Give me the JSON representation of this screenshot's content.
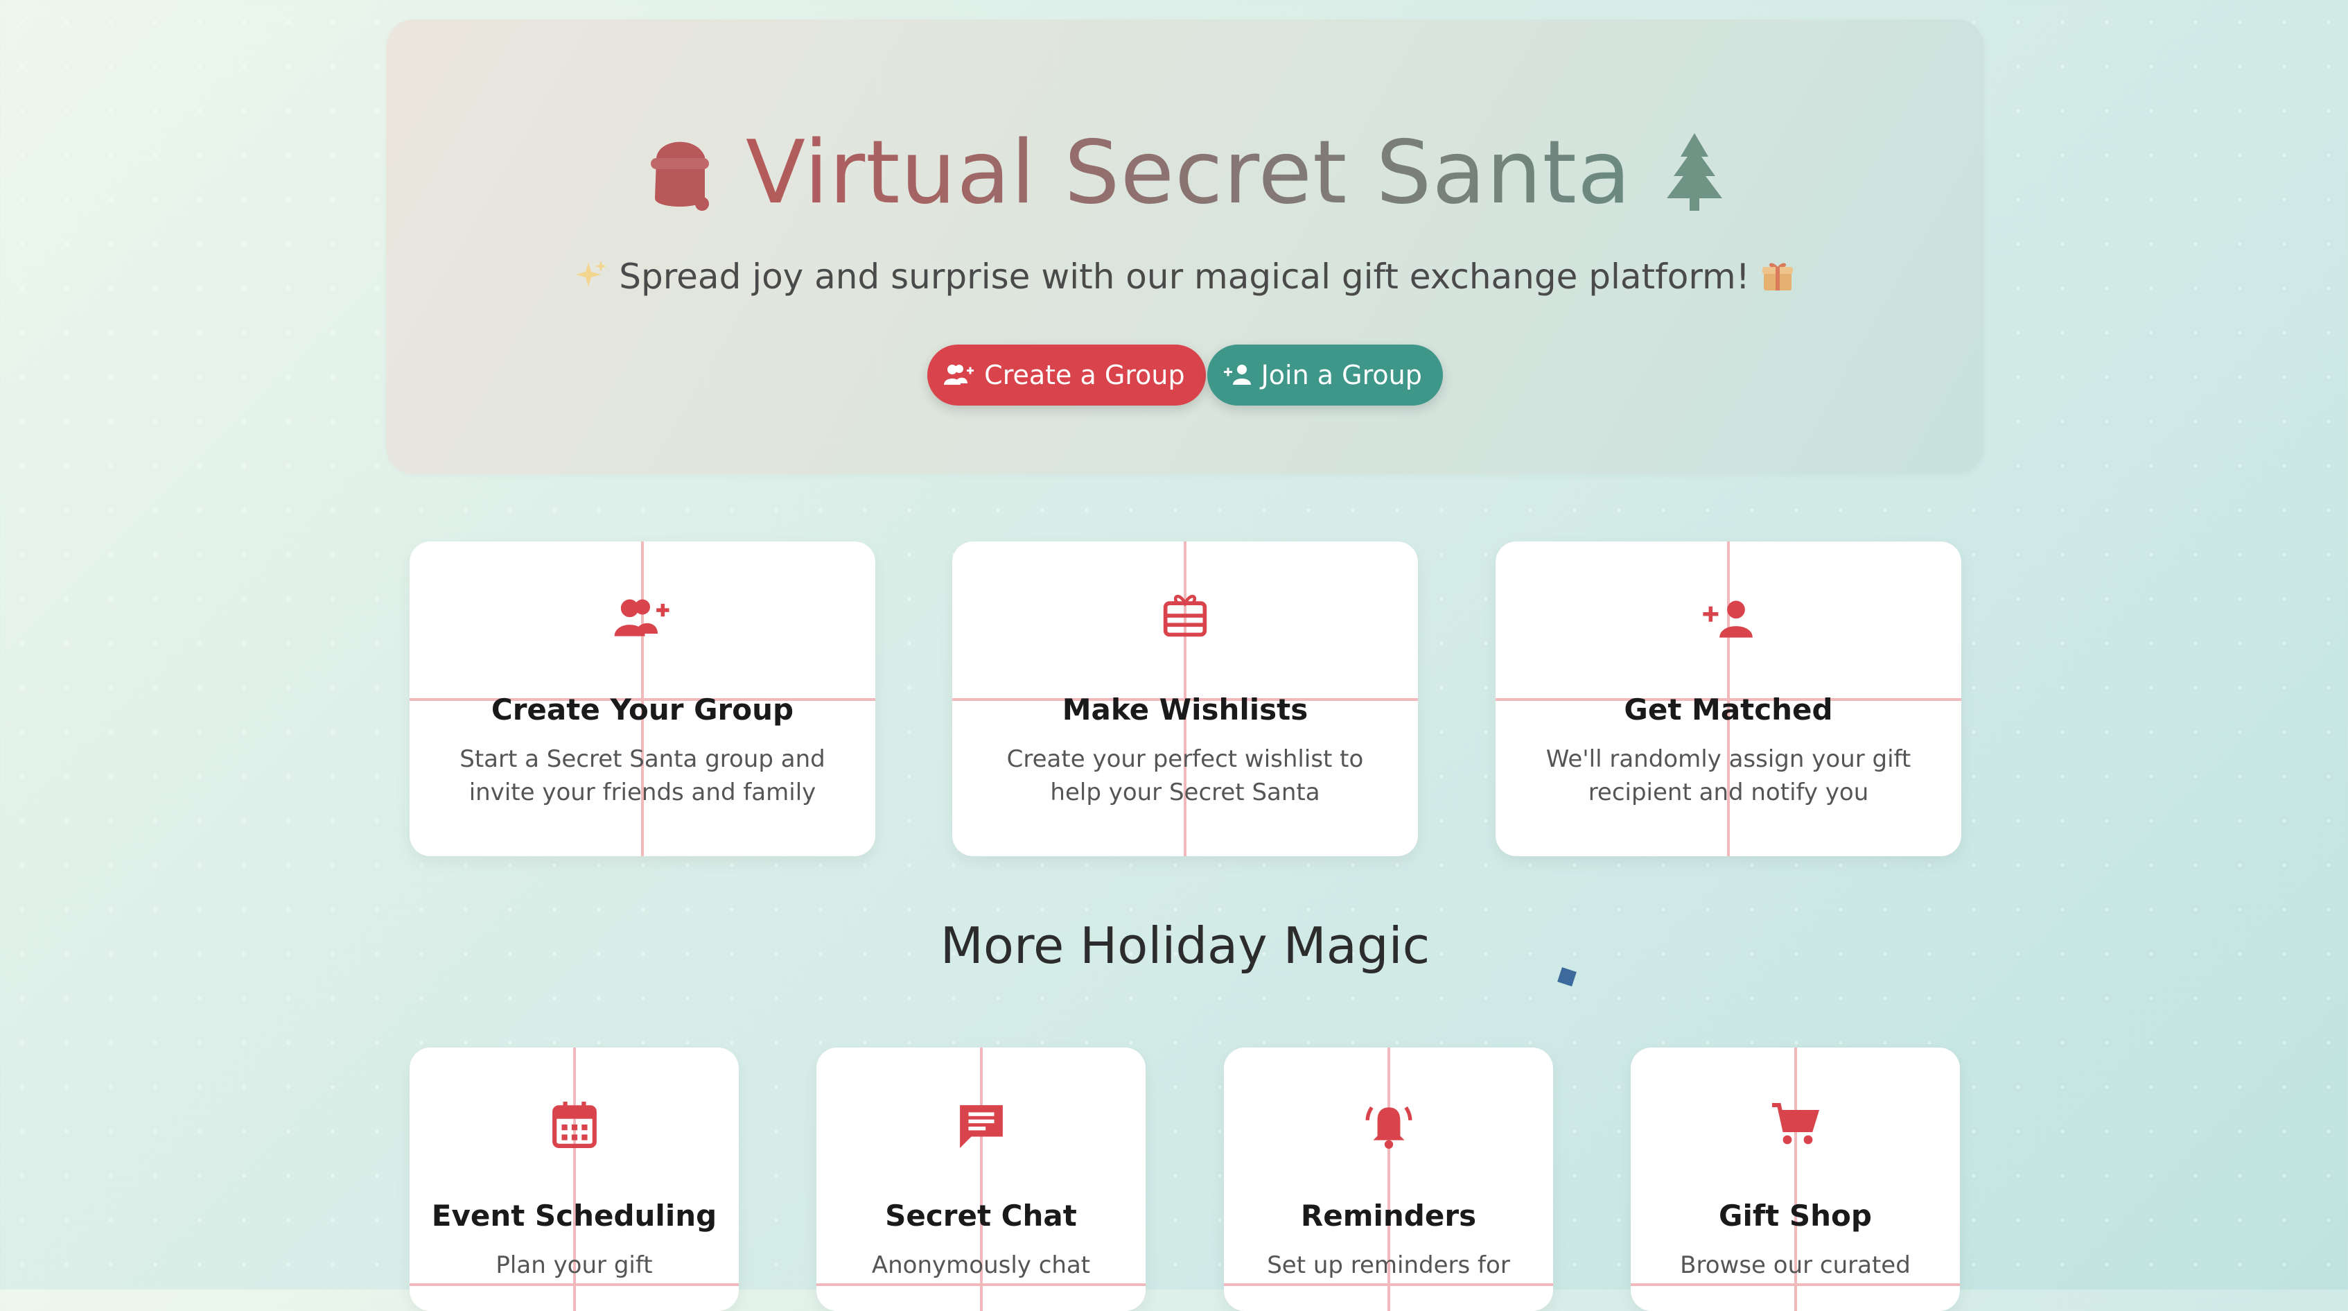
{
  "hero": {
    "title": "Virtual Secret Santa",
    "subtitle": "Spread joy and surprise with our magical gift exchange platform!",
    "create_button": "Create a Group",
    "join_button": "Join a Group"
  },
  "features": [
    {
      "icon": "group-add-icon",
      "title": "Create Your Group",
      "description": "Start a Secret Santa group and invite your friends and family"
    },
    {
      "icon": "gift-card-icon",
      "title": "Make Wishlists",
      "description": "Create your perfect wishlist to help your Secret Santa"
    },
    {
      "icon": "person-add-icon",
      "title": "Get Matched",
      "description": "We'll randomly assign your gift recipient and notify you"
    }
  ],
  "more_section": {
    "title": "More Holiday Magic",
    "items": [
      {
        "icon": "calendar-icon",
        "title": "Event Scheduling",
        "description": "Plan your gift"
      },
      {
        "icon": "chat-icon",
        "title": "Secret Chat",
        "description": "Anonymously chat"
      },
      {
        "icon": "bell-icon",
        "title": "Reminders",
        "description": "Set up reminders for"
      },
      {
        "icon": "cart-icon",
        "title": "Gift Shop",
        "description": "Browse our curated"
      }
    ]
  },
  "colors": {
    "accent_red": "#d9444c",
    "accent_teal": "#3f978a",
    "grid_line": "#f1b9bb"
  }
}
